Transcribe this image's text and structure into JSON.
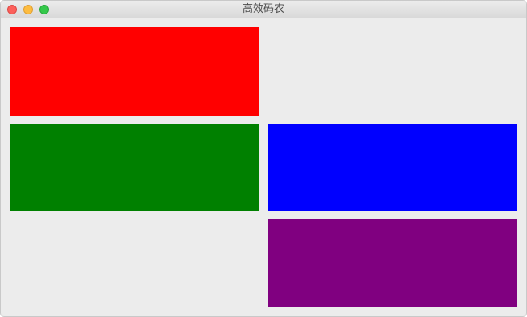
{
  "window": {
    "title": "高效码农"
  },
  "titlebar": {
    "controls": [
      "close-icon",
      "minimize-icon",
      "maximize-icon"
    ]
  },
  "blocks": [
    {
      "name": "red",
      "color": "#ff0000"
    },
    {
      "name": "green",
      "color": "#008000"
    },
    {
      "name": "blue",
      "color": "#0000ff"
    },
    {
      "name": "purple",
      "color": "#800080"
    }
  ]
}
